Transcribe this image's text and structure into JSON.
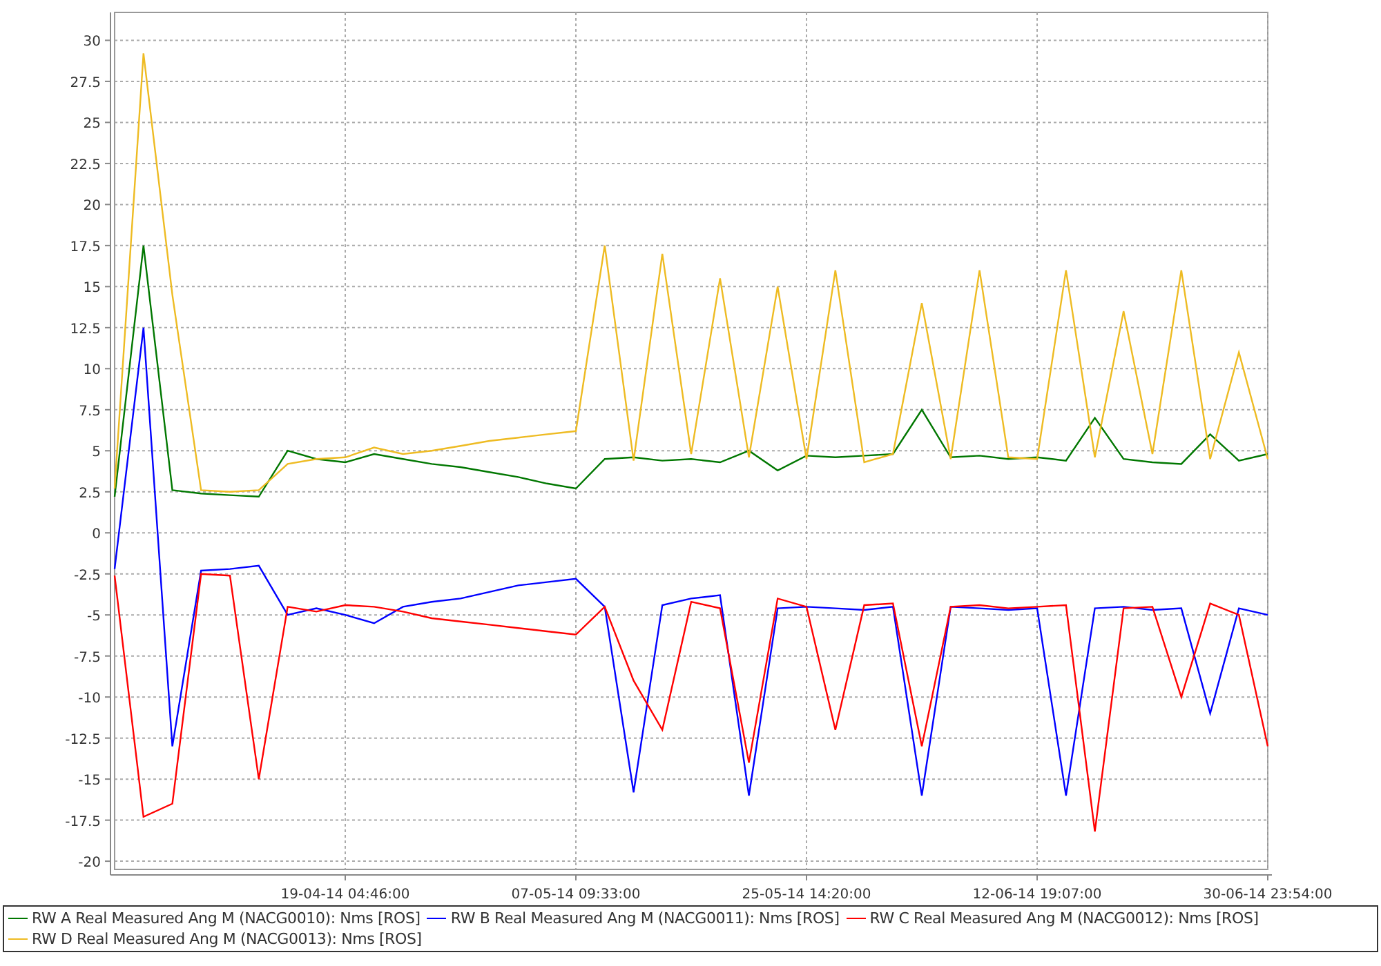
{
  "chart": {
    "chart_data": {
      "type": "line",
      "grid": true,
      "categories": [
        null,
        null,
        null,
        null,
        null,
        null,
        null,
        null,
        "19-04-14 04:46:00",
        null,
        null,
        null,
        null,
        null,
        null,
        null,
        "07-05-14 09:33:00",
        null,
        null,
        null,
        null,
        null,
        null,
        null,
        "25-05-14 14:20:00",
        null,
        null,
        null,
        null,
        null,
        null,
        null,
        "12-06-14 19:07:00",
        null,
        null,
        null,
        null,
        null,
        null,
        null,
        "30-06-14 23:54:00"
      ],
      "ylim": [
        -20.5,
        31.7
      ],
      "yticks": [
        -20,
        -17.5,
        -15,
        -12.5,
        -10,
        -7.5,
        -5,
        -2.5,
        0,
        2.5,
        5,
        7.5,
        10,
        12.5,
        15,
        17.5,
        20,
        22.5,
        25,
        27.5,
        30
      ],
      "series": [
        {
          "name": "RW A Real Measured Ang M (NACG0010): Nms [ROS]",
          "color": "#007700",
          "values": [
            2.2,
            17.5,
            2.6,
            2.4,
            2.3,
            2.2,
            5,
            4.5,
            4.3,
            4.8,
            4.5,
            4.2,
            4.0,
            3.7,
            3.4,
            3.0,
            2.7,
            4.5,
            4.6,
            4.4,
            4.5,
            4.3,
            5.0,
            3.8,
            4.7,
            4.6,
            4.7,
            4.8,
            7.5,
            4.6,
            4.7,
            4.5,
            4.6,
            4.4,
            7,
            4.5,
            4.3,
            4.2,
            6,
            4.4,
            4.8
          ]
        },
        {
          "name": "RW B Real Measured Ang M (NACG0011): Nms [ROS]",
          "color": "#0000ff",
          "values": [
            -2.2,
            12.5,
            -13,
            -2.3,
            -2.2,
            -2,
            -5,
            -4.6,
            -5,
            -5.5,
            -4.5,
            -4.2,
            -4,
            -3.6,
            -3.2,
            -3,
            -2.8,
            -4.5,
            -15.8,
            -4.4,
            -4,
            -3.8,
            -16,
            -4.6,
            -4.5,
            -4.6,
            -4.7,
            -4.5,
            -16,
            -4.5,
            -4.6,
            -4.7,
            -4.6,
            -16,
            -4.6,
            -4.5,
            -4.7,
            -4.6,
            -11,
            -4.6,
            -5
          ]
        },
        {
          "name": "RW C Real Measured Ang M (NACG0012): Nms [ROS]",
          "color": "#ff0000",
          "values": [
            -2.6,
            -17.3,
            -16.5,
            -2.5,
            -2.6,
            -15,
            -4.5,
            -4.8,
            -4.4,
            -4.5,
            -4.8,
            -5.2,
            -5.4,
            -5.6,
            -5.8,
            -6,
            -6.2,
            -4.5,
            -9,
            -12,
            -4.2,
            -4.6,
            -14,
            -4,
            -4.5,
            -12,
            -4.4,
            -4.3,
            -13,
            -4.5,
            -4.4,
            -4.6,
            -4.5,
            -4.4,
            -18.2,
            -4.6,
            -4.5,
            -10,
            -4.3,
            -5,
            -13
          ]
        },
        {
          "name": "RW D Real Measured Ang M (NACG0013): Nms [ROS]",
          "color": "#eebb22",
          "values": [
            2.7,
            29.2,
            14.5,
            2.6,
            2.5,
            2.6,
            4.2,
            4.5,
            4.6,
            5.2,
            4.8,
            5.0,
            5.3,
            5.6,
            5.8,
            6.0,
            6.2,
            17.5,
            4.4,
            17,
            4.8,
            15.5,
            4.6,
            15,
            4.5,
            16,
            4.3,
            4.8,
            14,
            4.5,
            16,
            4.6,
            4.5,
            16,
            4.6,
            13.5,
            4.8,
            16,
            4.5,
            11,
            4.5
          ]
        }
      ]
    }
  }
}
